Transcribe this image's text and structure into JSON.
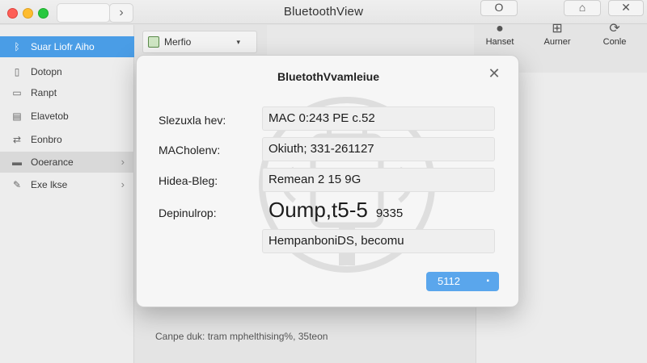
{
  "window": {
    "title": "BluetoothView",
    "nav_forward": "›",
    "toolbar_buttons": [
      "O",
      "⌂",
      "✕"
    ]
  },
  "sidebar": {
    "items": [
      {
        "label": "Suar Liofr Aiho",
        "icon": "bluetooth-icon",
        "glyph": "ᛒ",
        "selected": true
      },
      {
        "label": "Dotopn",
        "icon": "device-icon",
        "glyph": "▯"
      },
      {
        "label": "Ranpt",
        "icon": "monitor-icon",
        "glyph": "▭"
      },
      {
        "label": "Elavetob",
        "icon": "file-icon",
        "glyph": "▤"
      },
      {
        "label": "Eonbro",
        "icon": "connection-icon",
        "glyph": "⇄"
      },
      {
        "label": "Ooerance",
        "icon": "drive-icon",
        "glyph": "▬",
        "chevron": "›",
        "hovered": true
      },
      {
        "label": "Exe lkse",
        "icon": "tools-icon",
        "glyph": "✎",
        "chevron": "›"
      }
    ]
  },
  "main": {
    "dropdown_label": "Merfio",
    "dropdown_arrow": "▾",
    "actions": [
      {
        "label": "Hanset",
        "icon": "info-icon",
        "glyph": "●"
      },
      {
        "label": "Aurner",
        "icon": "grid-icon",
        "glyph": "⊞"
      },
      {
        "label": "Conle",
        "icon": "refresh-icon",
        "glyph": "⟳"
      }
    ],
    "status_text": "Canpe duk: tram mphelthising%, 35teon"
  },
  "modal": {
    "title": "BluetothVvamleiue",
    "close": "✕",
    "fields": [
      {
        "label": "Slezuxla hev:",
        "value": "MAC 0:243 PE c.52"
      },
      {
        "label": "MACholenv:",
        "value": "Okiuth; 331-261127"
      },
      {
        "label": "Hidea-Bleg:",
        "value": "Remean 2 15 9G"
      },
      {
        "label": "Depinulrop:",
        "value_big": "Oump,t5-5",
        "value_small": "9335"
      },
      {
        "label": "",
        "value": "HempanboniDS, becomu"
      }
    ],
    "button_label": "5112",
    "button_icon": "▪"
  },
  "colors": {
    "accent": "#4a9de6",
    "button": "#5aa6ec"
  }
}
